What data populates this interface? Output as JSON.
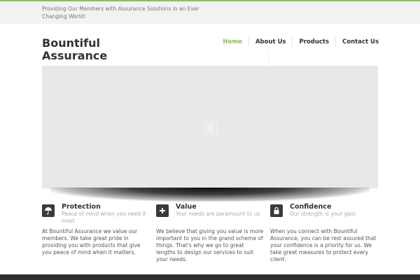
{
  "topbar": {
    "tagline": "Providing Our Members with Assurance Solutions in an Ever Changing World!"
  },
  "logo": {
    "line1": "Bountiful",
    "line2": "Assurance"
  },
  "nav": {
    "items": [
      {
        "label": "Home",
        "active": true
      },
      {
        "label": "About Us",
        "active": false
      },
      {
        "label": "Products",
        "active": false
      },
      {
        "label": "Contact Us",
        "active": false
      }
    ]
  },
  "slider": {
    "prev_icon": "chevron-left-icon"
  },
  "features": [
    {
      "icon": "umbrella-icon",
      "title": "Protection",
      "subtitle": "Peace of mind when you need it most",
      "body": "At Bountiful Assurance we value our members. We take great pride in providing you with products that give you peace of mind when it matters."
    },
    {
      "icon": "plus-icon",
      "title": "Value",
      "subtitle": "Your needs are paramount to us",
      "body": "We believe that giving you value is more important to you in the grand scheme of things. That's why we go to great lengths to design our services to suit your needs."
    },
    {
      "icon": "lock-icon",
      "title": "Confidence",
      "subtitle": "Our strength is your gain",
      "body": "When you connect with Bountiful Assurance, you can be rest assured that your confidence is a priority for us. We take great measures to protect every client."
    }
  ],
  "colors": {
    "accent": "#8cc152",
    "topbar_bg": "#f2f2f2",
    "slider_bg": "#e8e8e8",
    "icon_bg": "#3a3a3a",
    "footer_bg": "#2f2f2f"
  }
}
